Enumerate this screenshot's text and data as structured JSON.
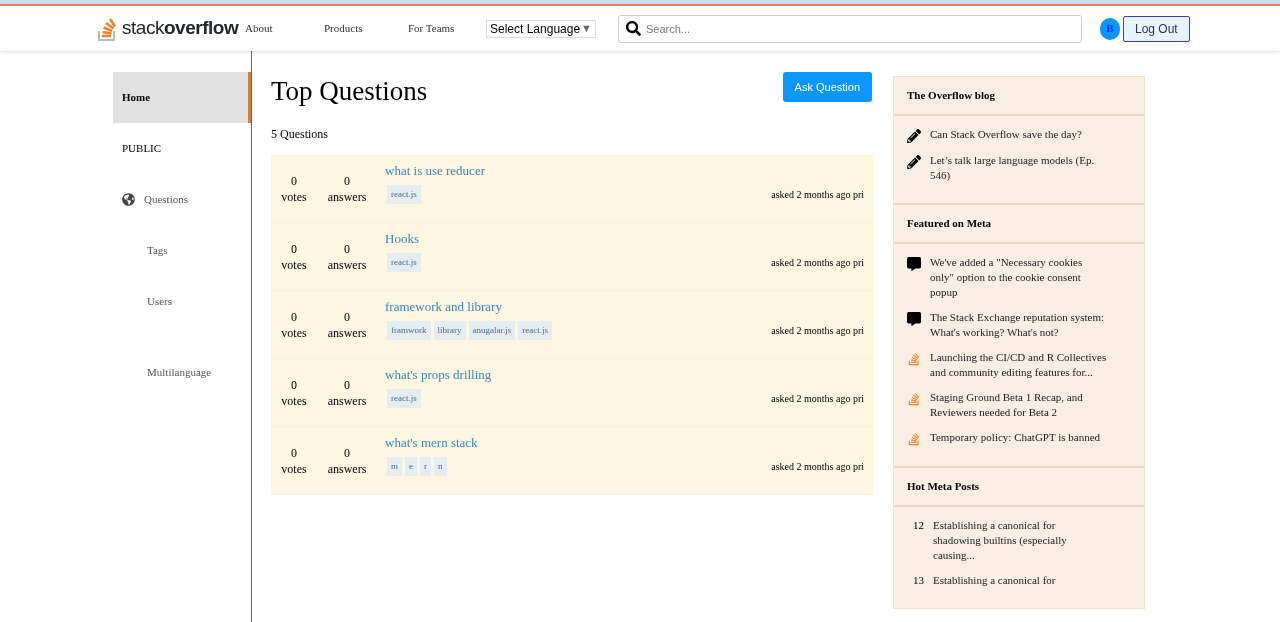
{
  "header": {
    "logo": {
      "light": "stack",
      "bold": "overflow"
    },
    "nav": [
      "About",
      "Products",
      "For Teams"
    ],
    "language_select": {
      "value": "Select Language",
      "caret": "▼"
    },
    "search": {
      "placeholder": "Search..."
    },
    "avatar": "B",
    "logout": "Log Out"
  },
  "sidebar": {
    "items": [
      {
        "label": "Home",
        "kind": "main",
        "selected": true
      },
      {
        "label": "PUBLIC",
        "kind": "heading",
        "selected": false
      },
      {
        "label": "Questions",
        "kind": "globe",
        "selected": false
      },
      {
        "label": "Tags",
        "kind": "sub",
        "selected": false
      },
      {
        "label": "Users",
        "kind": "sub",
        "selected": false
      },
      {
        "label": "Multilanguage",
        "kind": "sub-far",
        "selected": false
      }
    ]
  },
  "main": {
    "title": "Top Questions",
    "ask_button": "Ask Question",
    "count": "5 Questions",
    "questions": [
      {
        "votes": "0",
        "votes_label": "votes",
        "answers": "0",
        "answers_label": "answers",
        "title": "what is use reducer",
        "tags": [
          "react.js"
        ],
        "asked": "asked 2 months ago pri"
      },
      {
        "votes": "0",
        "votes_label": "votes",
        "answers": "0",
        "answers_label": "answers",
        "title": "Hooks",
        "tags": [
          "react.js"
        ],
        "asked": "asked 2 months ago pri"
      },
      {
        "votes": "0",
        "votes_label": "votes",
        "answers": "0",
        "answers_label": "answers",
        "title": "framework and library",
        "tags": [
          "framwork",
          "library",
          "anugalar.js",
          "react.js"
        ],
        "asked": "asked 2 months ago pri"
      },
      {
        "votes": "0",
        "votes_label": "votes",
        "answers": "0",
        "answers_label": "answers",
        "title": "what's props drilling",
        "tags": [
          "react.js"
        ],
        "asked": "asked 2 months ago pri"
      },
      {
        "votes": "0",
        "votes_label": "votes",
        "answers": "0",
        "answers_label": "answers",
        "title": "what's mern stack",
        "tags": [
          "m",
          "e",
          "r",
          "n"
        ],
        "asked": "asked 2 months ago pri"
      }
    ]
  },
  "widget": {
    "sections": [
      {
        "title": "The Overflow blog",
        "items": [
          {
            "kind": "pencil",
            "text": "Can Stack Overflow save the day?"
          },
          {
            "kind": "pencil",
            "text": "Let’s talk large language models (Ep. 546)"
          }
        ]
      },
      {
        "title": "Featured on Meta",
        "items": [
          {
            "kind": "comment",
            "text": "We've added a \"Necessary cookies only\" option to the cookie consent popup"
          },
          {
            "kind": "comment",
            "text": "The Stack Exchange reputation system: What's working? What's not?"
          },
          {
            "kind": "stack",
            "text": "Launching the CI/CD and R Collectives and community editing features for..."
          },
          {
            "kind": "stack",
            "text": "Staging Ground Beta 1 Recap, and Reviewers needed for Beta 2"
          },
          {
            "kind": "stack",
            "text": "Temporary policy: ChatGPT is banned"
          }
        ]
      },
      {
        "title": "Hot Meta Posts",
        "items": [
          {
            "kind": "number",
            "number": "12",
            "text": "Establishing a canonical for shadowing builtins (especially causing..."
          },
          {
            "kind": "number",
            "number": "13",
            "text": "Establishing a canonical for"
          }
        ]
      }
    ]
  }
}
